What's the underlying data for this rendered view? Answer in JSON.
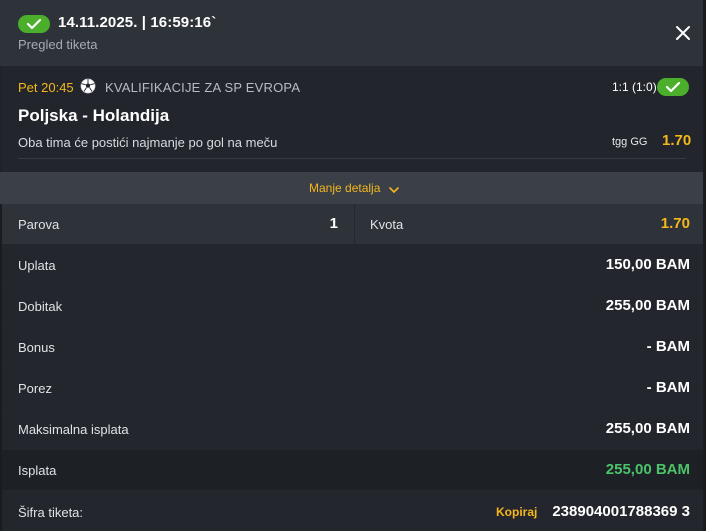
{
  "header": {
    "datetime": "14.11.2025. | 16:59:16`",
    "subtitle": "Pregled tiketa"
  },
  "match": {
    "time": "Pet 20:45",
    "competition": "KVALIFIKACIJE ZA SP EVROPA",
    "score": "1:1 (1:0)",
    "teams": "Poljska - Holandija",
    "pick": "Oba tima će postići najmanje po gol na meču",
    "market": "tgg GG",
    "odds": "1.70"
  },
  "toggle_label": "Manje detalja",
  "summary": {
    "parova_label": "Parova",
    "parova_value": "1",
    "kvota_label": "Kvota",
    "kvota_value": "1.70",
    "uplata_label": "Uplata",
    "uplata_value": "150,00 BAM",
    "dobitak_label": "Dobitak",
    "dobitak_value": "255,00 BAM",
    "bonus_label": "Bonus",
    "bonus_value": "- BAM",
    "porez_label": "Porez",
    "porez_value": "- BAM",
    "max_label": "Maksimalna isplata",
    "max_value": "255,00 BAM",
    "isplata_label": "Isplata",
    "isplata_value": "255,00 BAM",
    "sifra_label": "Šifra tiketa:",
    "copy_label": "Kopiraj",
    "ticket_code": "238904001788369 3"
  },
  "colors": {
    "accent": "#f5b81c",
    "success": "#4caf2c",
    "payout": "#4cc36a"
  },
  "icons": {
    "win_badge": "checkmark-icon",
    "close": "close-icon",
    "sport": "soccer-ball-icon",
    "toggle": "chevron-down-icon"
  }
}
